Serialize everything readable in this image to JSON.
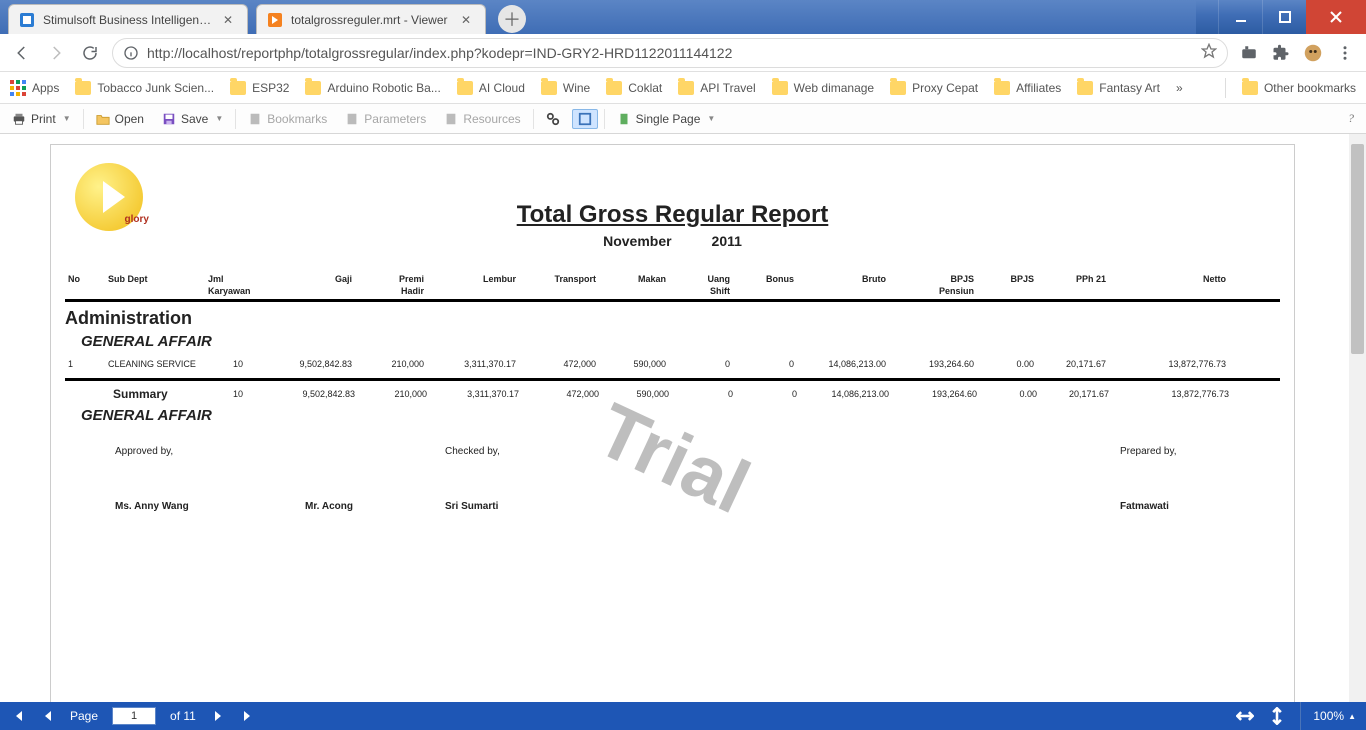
{
  "tabs": [
    {
      "title": "Stimulsoft Business Intelligence S"
    },
    {
      "title": "totalgrossreguler.mrt - Viewer"
    }
  ],
  "url": "http://localhost/reportphp/totalgrossregular/index.php?kodepr=IND-GRY2-HRD1122011144122",
  "bookmarks": {
    "apps": "Apps",
    "items": [
      "Tobacco Junk Scien...",
      "ESP32",
      "Arduino Robotic Ba...",
      "AI Cloud",
      "Wine",
      "Coklat",
      "API Travel",
      "Web dimanage",
      "Proxy Cepat",
      "Affiliates",
      "Fantasy Art"
    ],
    "more": "»",
    "other": "Other bookmarks"
  },
  "viewer": {
    "print": "Print",
    "open": "Open",
    "save": "Save",
    "bookmarks": "Bookmarks",
    "parameters": "Parameters",
    "resources": "Resources",
    "single": "Single Page"
  },
  "report": {
    "logo": "glory",
    "title": "Total Gross Regular Report",
    "month": "November",
    "year": "2011",
    "headers": {
      "no": "No",
      "subdept": "Sub Dept",
      "jml1": "Jml",
      "jml2": "Karyawan",
      "gaji": "Gaji",
      "premi1": "Premi",
      "premi2": "Hadir",
      "lembur": "Lembur",
      "transport": "Transport",
      "makan": "Makan",
      "uang1": "Uang",
      "uang2": "Shift",
      "bonus": "Bonus",
      "bruto": "Bruto",
      "bpjsp1": "BPJS",
      "bpjsp2": "Pensiun",
      "bpjs": "BPJS",
      "pph": "PPh 21",
      "netto": "Netto"
    },
    "sect": "Administration",
    "dept": "GENERAL AFFAIR",
    "row": {
      "no": "1",
      "subdept": "CLEANING SERVICE",
      "jml": "10",
      "gaji": "9,502,842.83",
      "premi": "210,000",
      "lembur": "3,311,370.17",
      "transport": "472,000",
      "makan": "590,000",
      "uang": "0",
      "bonus": "0",
      "bruto": "14,086,213.00",
      "bpjsp": "193,264.60",
      "bpjs": "0.00",
      "pph": "20,171.67",
      "netto": "13,872,776.73"
    },
    "summary": "Summary",
    "sumrow": {
      "jml": "10",
      "gaji": "9,502,842.83",
      "premi": "210,000",
      "lembur": "3,311,370.17",
      "transport": "472,000",
      "makan": "590,000",
      "uang": "0",
      "bonus": "0",
      "bruto": "14,086,213.00",
      "bpjsp": "193,264.60",
      "bpjs": "0.00",
      "pph": "20,171.67",
      "netto": "13,872,776.73"
    },
    "dept2": "GENERAL AFFAIR",
    "sig": {
      "approved": "Approved by,",
      "checked": "Checked by,",
      "prepared": "Prepared by,",
      "name1": "Ms. Anny Wang",
      "name2": "Mr. Acong",
      "name3": "Sri Sumarti",
      "name4": "Fatmawati"
    },
    "wm": "Trial"
  },
  "pager": {
    "page": "Page",
    "current": "1",
    "of": "of 11",
    "zoom": "100%"
  }
}
